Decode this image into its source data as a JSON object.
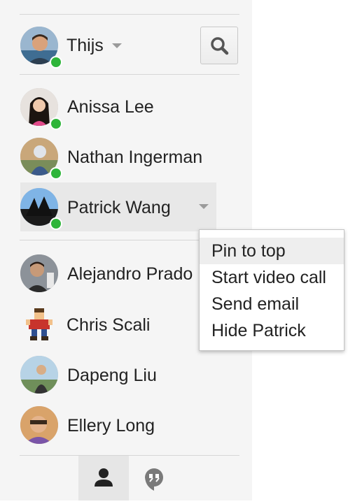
{
  "header": {
    "user_name": "Thijs",
    "user_status": "online"
  },
  "contacts": [
    {
      "name": "Anissa Lee",
      "status": "online"
    },
    {
      "name": "Nathan Ingerman",
      "status": "online"
    },
    {
      "name": "Patrick Wang",
      "status": "online"
    },
    {
      "name": "Alejandro Prado",
      "status": "offline"
    },
    {
      "name": "Chris Scali",
      "status": "offline"
    },
    {
      "name": "Dapeng Liu",
      "status": "offline"
    },
    {
      "name": "Ellery Long",
      "status": "offline"
    }
  ],
  "context_menu": {
    "items": [
      {
        "label": "Pin to top"
      },
      {
        "label": "Start video call"
      },
      {
        "label": "Send email"
      },
      {
        "label": "Hide Patrick"
      }
    ]
  },
  "bottom_tabs": [
    {
      "icon": "person-icon",
      "active": true
    },
    {
      "icon": "hangouts-quote-icon",
      "active": false
    }
  ],
  "colors": {
    "online": "#2fb53a",
    "panel_bg": "#f5f5f5",
    "highlight": "#e8e8e8"
  }
}
